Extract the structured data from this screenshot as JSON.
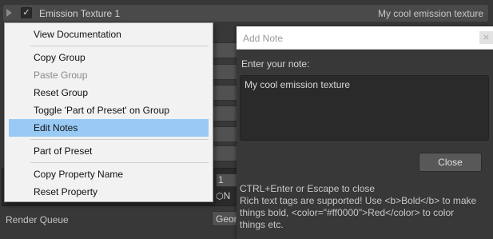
{
  "group": {
    "checkbox_glyph": "✓",
    "title": "Emission Texture 1",
    "note": "My cool emission texture"
  },
  "background": {
    "field_value": "1",
    "field_label": "N",
    "render_queue_label": "Render Queue",
    "render_queue_value": "Geor"
  },
  "context_menu": {
    "items": [
      {
        "label": "View Documentation",
        "enabled": true
      },
      {
        "label": "Copy Group",
        "enabled": true
      },
      {
        "label": "Paste Group",
        "enabled": false
      },
      {
        "label": "Reset Group",
        "enabled": true
      },
      {
        "label": "Toggle 'Part of Preset' on Group",
        "enabled": true
      },
      {
        "label": "Edit Notes",
        "enabled": true,
        "highlighted": true
      },
      {
        "label": "Part of Preset",
        "enabled": true
      },
      {
        "label": "Copy Property Name",
        "enabled": true
      },
      {
        "label": "Reset Property",
        "enabled": true
      }
    ],
    "highlight_color": "#99c9f5"
  },
  "note_window": {
    "title": "Add Note",
    "prompt": "Enter your note:",
    "value": "My cool emission texture",
    "close_label": "Close",
    "hint_1": "CTRL+Enter or Escape to close",
    "hint_2": "Rich text tags are supported! Use <b>Bold</b> to make",
    "hint_3": "things bold, <color=\"#ff0000\">Red</color> to color",
    "hint_4": "things etc."
  }
}
